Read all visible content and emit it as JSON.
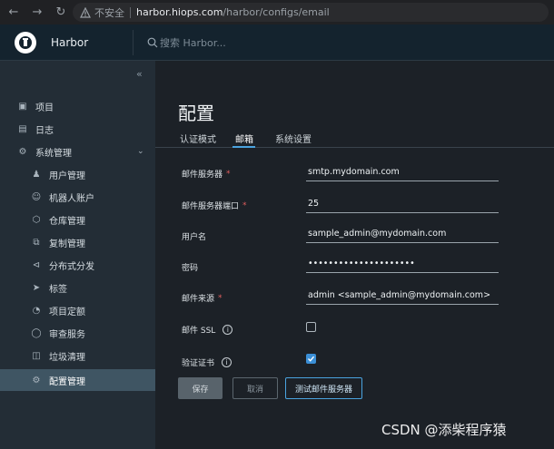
{
  "browser": {
    "insecure_label": "不安全",
    "url_host": "harbor.hiops.com",
    "url_path": "/harbor/configs/email"
  },
  "app": {
    "title": "Harbor",
    "search_placeholder": "搜索 Harbor..."
  },
  "sidebar": {
    "items": [
      {
        "label": "项目",
        "icon": "projects-icon"
      },
      {
        "label": "日志",
        "icon": "logs-icon"
      },
      {
        "label": "系统管理",
        "icon": "admin-icon"
      }
    ],
    "sub_items": [
      {
        "label": "用户管理",
        "icon": "users-icon"
      },
      {
        "label": "机器人账户",
        "icon": "robot-icon"
      },
      {
        "label": "仓库管理",
        "icon": "registry-icon"
      },
      {
        "label": "复制管理",
        "icon": "replication-icon"
      },
      {
        "label": "分布式分发",
        "icon": "distribution-icon"
      },
      {
        "label": "标签",
        "icon": "label-icon"
      },
      {
        "label": "项目定额",
        "icon": "quota-icon"
      },
      {
        "label": "审查服务",
        "icon": "shield-icon"
      },
      {
        "label": "垃圾清理",
        "icon": "trash-icon"
      },
      {
        "label": "配置管理",
        "icon": "gear-icon"
      }
    ]
  },
  "main": {
    "title": "配置",
    "tabs": [
      "认证模式",
      "邮箱",
      "系统设置"
    ],
    "form": {
      "server_label": "邮件服务器",
      "server_value": "smtp.mydomain.com",
      "port_label": "邮件服务器端口",
      "port_value": "25",
      "username_label": "用户名",
      "username_value": "sample_admin@mydomain.com",
      "password_label": "密码",
      "password_value": "•••••••••••••••••••••",
      "from_label": "邮件来源",
      "from_value": "admin <sample_admin@mydomain.com>",
      "ssl_label": "邮件 SSL",
      "ssl_checked": false,
      "verify_label": "验证证书",
      "verify_checked": true
    },
    "buttons": {
      "save": "保存",
      "cancel": "取消",
      "test": "测试邮件服务器"
    }
  },
  "watermark": "CSDN @添柴程序猿",
  "colors": {
    "accent": "#4aa3df",
    "checkbox": "#3b8fd6",
    "required": "#e05e5e"
  }
}
